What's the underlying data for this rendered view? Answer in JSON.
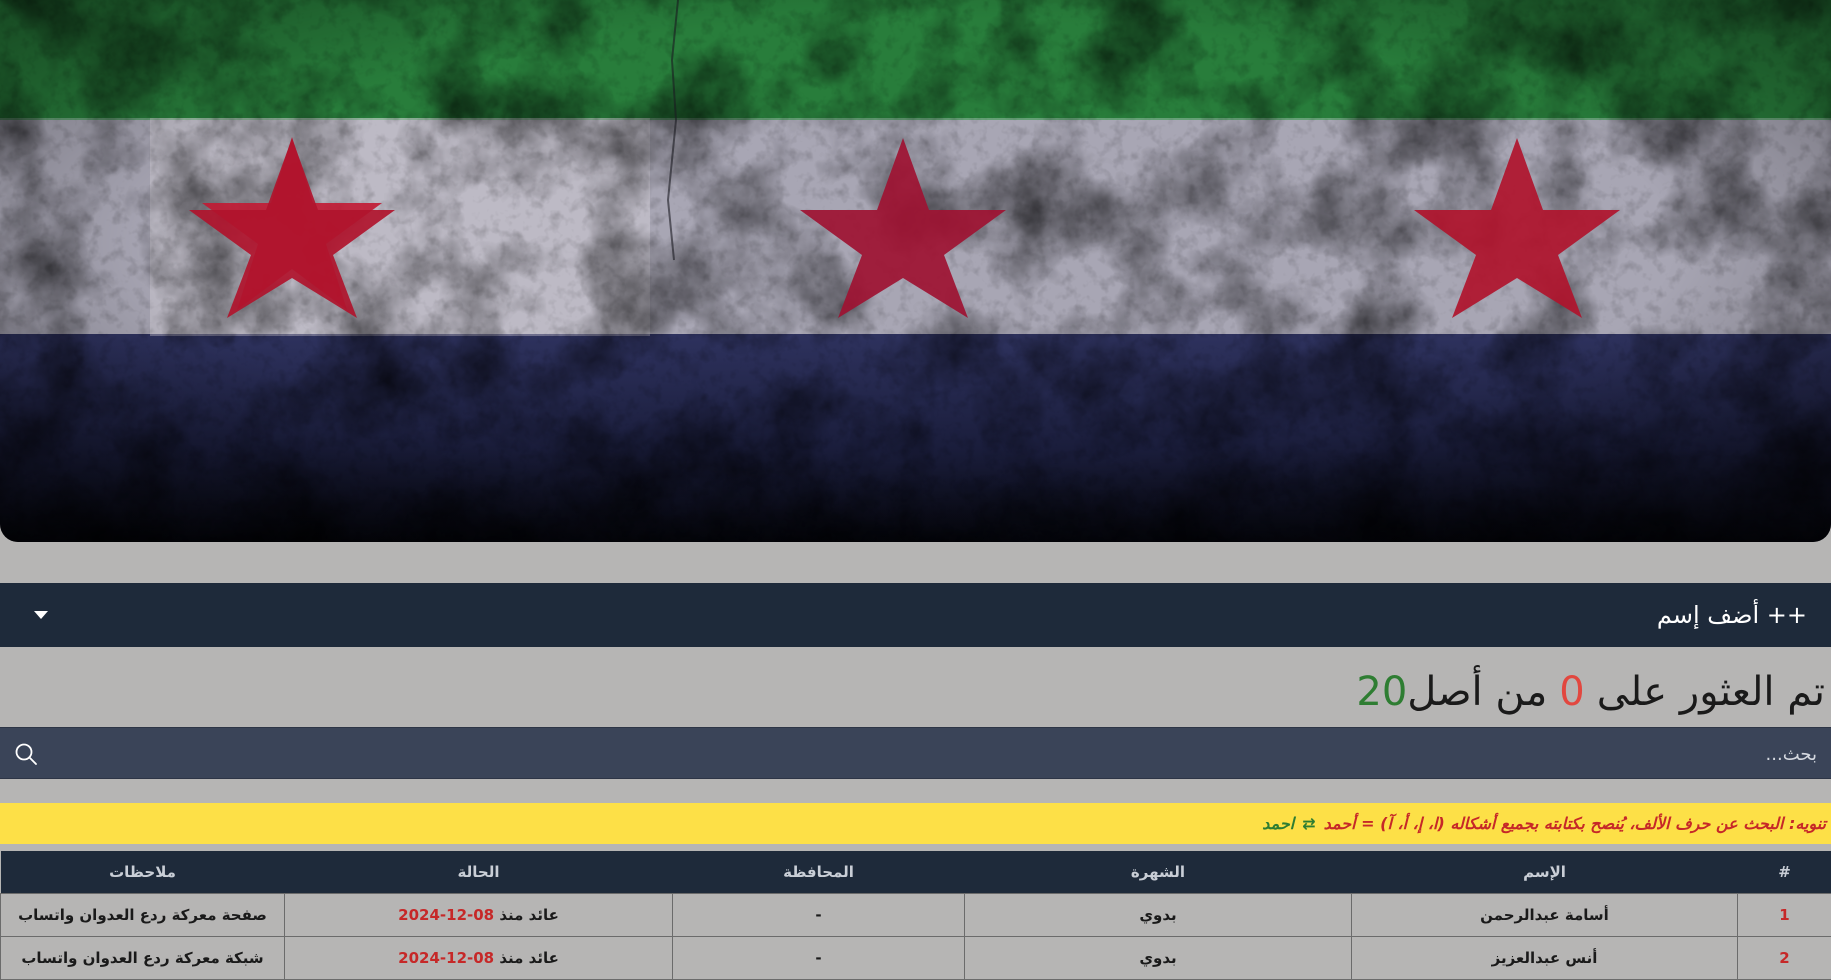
{
  "header": {
    "add_name_label": "++ أضف إسم"
  },
  "results": {
    "prefix": "تم العثور على",
    "found": "0",
    "middle": "من أصل",
    "total": "20"
  },
  "search": {
    "placeholder": "بحث..."
  },
  "notice": {
    "text": "تنويه: البحث عن حرف الألف، يُنصح بكتابته بجميع أشكاله (ا، إ، أ، آ) = أحمد",
    "swap_symbol": "⇄",
    "alt": "احمد"
  },
  "table": {
    "headers": [
      "#",
      "الإسم",
      "الشهرة",
      "المحافظة",
      "الحالة",
      "ملاحظات"
    ],
    "rows": [
      {
        "num": "1",
        "name": "أسامة عبدالرحمن",
        "nickname": "بدوي",
        "governorate": "-",
        "status_text": "عائد منذ",
        "status_date": "08-12-2024",
        "notes": "صفحة معركة ردع العدوان واتساب"
      },
      {
        "num": "2",
        "name": "أنس عبدالعزيز",
        "nickname": "بدوي",
        "governorate": "-",
        "status_text": "عائد منذ",
        "status_date": "08-12-2024",
        "notes": "شبكة معركة ردع العدوان واتساب"
      }
    ]
  },
  "colors": {
    "navbar": "#1e2a3a",
    "background": "#b6b5b4",
    "search_bg": "#3a4458",
    "notice_bg": "#fde047",
    "accent_red": "#e2473f",
    "accent_green": "#2e7d32"
  },
  "icons": {
    "search": "search-icon",
    "dropdown": "caret-down-icon"
  }
}
